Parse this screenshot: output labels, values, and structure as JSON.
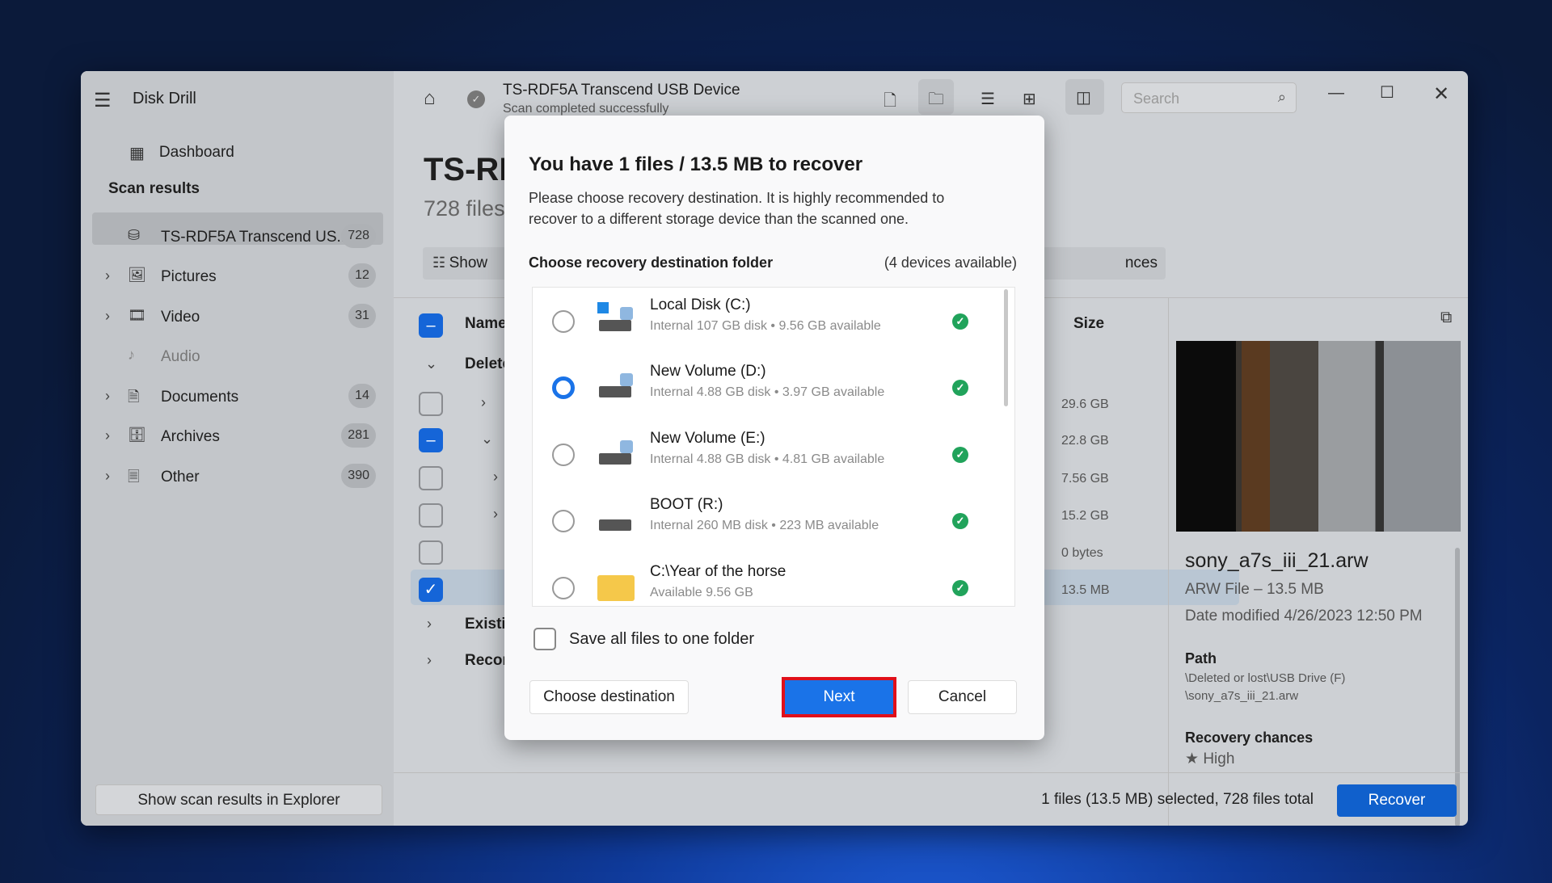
{
  "app": {
    "title": "Disk Drill"
  },
  "sidebar": {
    "dashboard": "Dashboard",
    "section": "Scan results",
    "items": [
      {
        "label": "TS-RDF5A Transcend US...",
        "count": "728",
        "icon": "drive-icon"
      },
      {
        "label": "Pictures",
        "count": "12",
        "icon": "image-icon"
      },
      {
        "label": "Video",
        "count": "31",
        "icon": "film-icon"
      },
      {
        "label": "Audio",
        "count": "",
        "icon": "music-icon"
      },
      {
        "label": "Documents",
        "count": "14",
        "icon": "document-icon"
      },
      {
        "label": "Archives",
        "count": "281",
        "icon": "archive-icon"
      },
      {
        "label": "Other",
        "count": "390",
        "icon": "file-icon"
      }
    ],
    "explorer_button": "Show scan results in Explorer"
  },
  "header": {
    "device": "TS-RDF5A Transcend USB Device",
    "status": "Scan completed successfully",
    "search_placeholder": "Search"
  },
  "main": {
    "title": "TS-RD",
    "subtitle": "728 files",
    "show_button": "Show",
    "chances_button": "nces",
    "columns": {
      "name": "Name",
      "size": "Size"
    },
    "groups": [
      "Delete",
      "Existir",
      "Recon"
    ],
    "sizes": [
      "29.6 GB",
      "22.8 GB",
      "7.56 GB",
      "15.2 GB",
      "0 bytes",
      "13.5 MB"
    ]
  },
  "preview": {
    "filename": "sony_a7s_iii_21.arw",
    "type": "ARW File – 13.5 MB",
    "date": "Date modified 4/26/2023 12:50 PM",
    "path_label": "Path",
    "path1": "\\Deleted or lost\\USB Drive (F)",
    "path2": "\\sony_a7s_iii_21.arw",
    "chances_label": "Recovery chances",
    "chances": "High"
  },
  "status": {
    "text": "1 files (13.5 MB) selected, 728 files total",
    "recover": "Recover"
  },
  "dialog": {
    "title": "You have 1 files / 13.5 MB to recover",
    "desc1": "Please choose recovery destination. It is highly recommended to",
    "desc2": "recover to a different storage device than the scanned one.",
    "choose_label": "Choose recovery destination folder",
    "available": "(4 devices available)",
    "destinations": [
      {
        "name": "Local Disk (C:)",
        "detail": "Internal 107 GB disk • 9.56 GB available",
        "selected": false
      },
      {
        "name": "New Volume (D:)",
        "detail": "Internal 4.88 GB disk • 3.97 GB available",
        "selected": true
      },
      {
        "name": "New Volume (E:)",
        "detail": "Internal 4.88 GB disk • 4.81 GB available",
        "selected": false
      },
      {
        "name": "BOOT (R:)",
        "detail": "Internal 260 MB disk • 223 MB available",
        "selected": false
      },
      {
        "name": "C:\\Year of the horse",
        "detail": "Available 9.56 GB",
        "selected": false
      }
    ],
    "save_one_folder": "Save all files to one folder",
    "choose_button": "Choose destination",
    "next_button": "Next",
    "cancel_button": "Cancel"
  },
  "colors": {
    "accent": "#1a73e8",
    "highlight": "#e0101a",
    "ok": "#21a35b"
  }
}
